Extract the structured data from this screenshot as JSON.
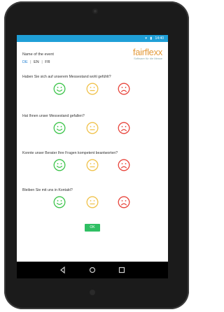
{
  "header": {
    "event_label": "Name of the event",
    "languages": [
      "DE",
      "EN",
      "FR"
    ],
    "active_language": "DE",
    "separator": "|"
  },
  "logo": {
    "text": "fairflexx",
    "subtitle": "Software für die Messe"
  },
  "status_bar": {
    "time": "14:40",
    "color": "#1f9fd7"
  },
  "questions": [
    {
      "text": "Haben Sie sich auf unserem Messestand wohl gefühlt?"
    },
    {
      "text": "Hat Ihnen unser Messestand gefallen?"
    },
    {
      "text": "Konnte unser Berater Ihre Fragen kompetent beantworten?"
    },
    {
      "text": "Bleiben Sie mit uns in Kontakt?"
    }
  ],
  "ratings": [
    {
      "name": "happy",
      "color": "#3cc44a"
    },
    {
      "name": "neutral",
      "color": "#f0c24b"
    },
    {
      "name": "sad",
      "color": "#e8453c"
    }
  ],
  "submit": {
    "label": "OK",
    "color": "#2fbf63"
  }
}
